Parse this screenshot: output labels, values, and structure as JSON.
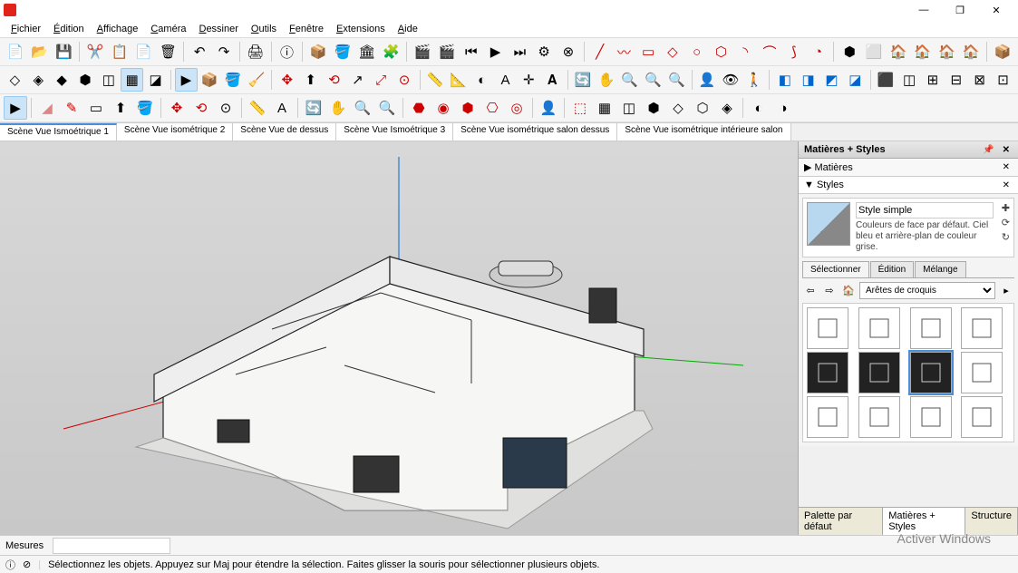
{
  "window": {
    "title": "",
    "minimize": "—",
    "maximize": "❐",
    "close": "✕"
  },
  "menu": [
    "Fichier",
    "Édition",
    "Affichage",
    "Caméra",
    "Dessiner",
    "Outils",
    "Fenêtre",
    "Extensions",
    "Aide"
  ],
  "scene_tabs": [
    "Scène Vue Ismoétrique 1",
    "Scène Vue isométrique 2",
    "Scène Vue de dessus",
    "Scène Vue Ismoétrique 3",
    "Scène Vue isométrique salon dessus",
    "Scène Vue isométrique intérieure salon"
  ],
  "panel": {
    "title": "Matières + Styles",
    "sections": {
      "materials": "Matières",
      "styles": "Styles"
    },
    "style_name": "Style simple",
    "style_desc": "Couleurs de face par défaut. Ciel bleu et arrière-plan de couleur grise.",
    "style_tabs": [
      "Sélectionner",
      "Édition",
      "Mélange"
    ],
    "dropdown": "Arêtes de croquis"
  },
  "bottom_tabs": [
    "Palette par défaut",
    "Matières + Styles",
    "Structure"
  ],
  "measures": {
    "label": "Mesures",
    "value": ""
  },
  "status": {
    "hint": "Sélectionnez les objets. Appuyez sur Maj pour étendre la sélection. Faites glisser la souris pour sélectionner plusieurs objets."
  },
  "watermark": "Activer Windows"
}
